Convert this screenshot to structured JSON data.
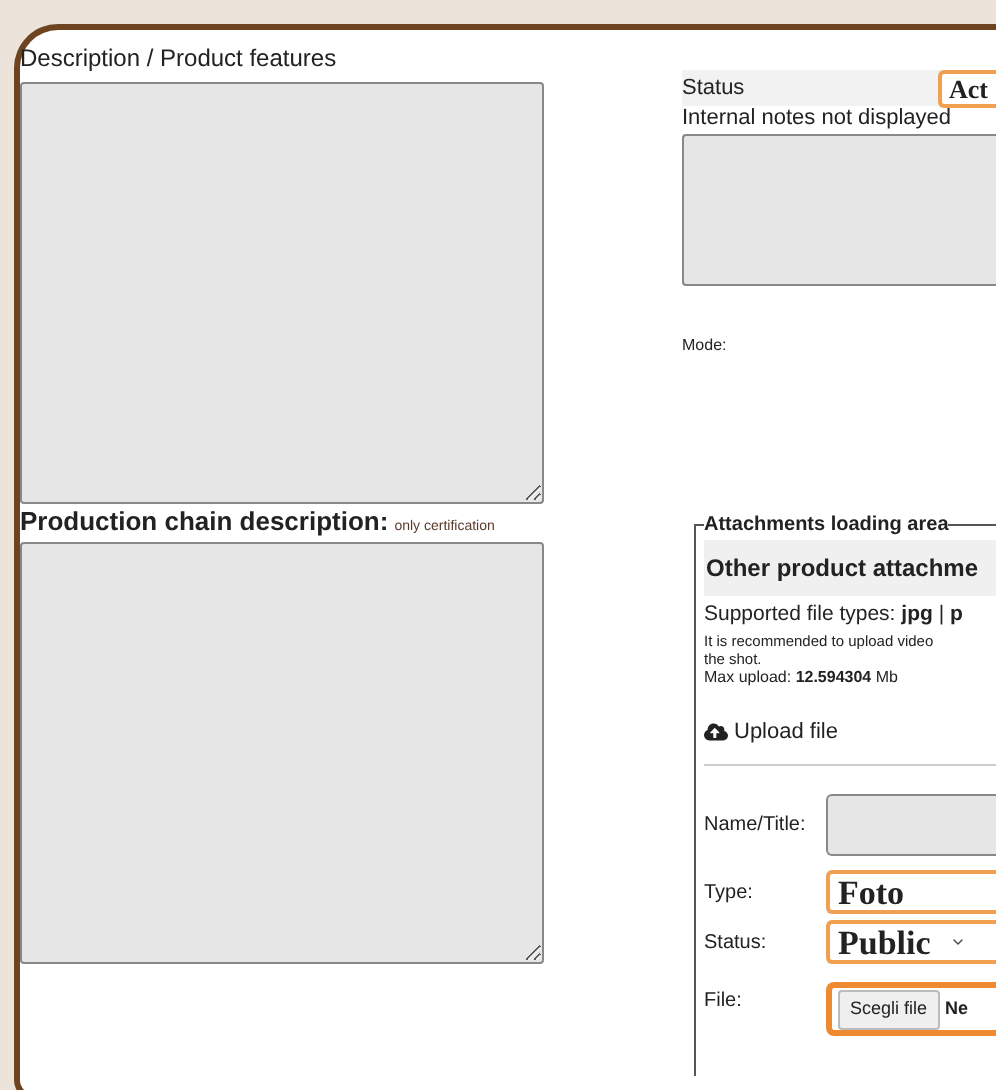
{
  "description": {
    "label": "Description / Product features"
  },
  "production_chain": {
    "label": "Production chain description:",
    "note": "only certification"
  },
  "status": {
    "label": "Status",
    "value": "Act"
  },
  "internal_notes": {
    "label": "Internal notes not displayed"
  },
  "mode": {
    "label": "Mode:"
  },
  "attachments": {
    "legend": "Attachments loading area",
    "title": "Other product attachme",
    "file_types": "Supported file types: **jpg** | **p**",
    "recommendation": "It is recommended to upload video",
    "recommendation_2": "the shot.",
    "max_upload": "Max upload: **12.594304** Mb",
    "upload_link": "Upload file",
    "form": {
      "name_label": "Name/Title:",
      "type_label": "Type:",
      "type_value": "Foto",
      "status_label": "Status:",
      "status_value": "Public",
      "file_label": "File:",
      "file_button": "Scegli file",
      "file_status": "Ne"
    }
  }
}
